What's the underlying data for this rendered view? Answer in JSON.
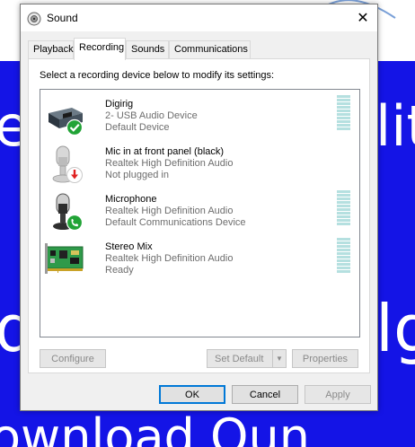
{
  "wallpaper": {
    "line1_left": "e",
    "line1_right": "lit",
    "line2_left": "d",
    "line2_right": "lg",
    "line3": "ownload Oun"
  },
  "window": {
    "title": "Sound",
    "close_glyph": "✕"
  },
  "tabs": [
    {
      "label": "Playback"
    },
    {
      "label": "Recording"
    },
    {
      "label": "Sounds"
    },
    {
      "label": "Communications"
    }
  ],
  "instruction": "Select a recording device below to modify its settings:",
  "devices": [
    {
      "name": "Digirig",
      "line2": "2- USB Audio Device",
      "line3": "Default Device",
      "icon": "usb-audio-icon",
      "badge": "checkmark-badge"
    },
    {
      "name": "Mic in at front panel (black)",
      "line2": "Realtek High Definition Audio",
      "line3": "Not plugged in",
      "icon": "microphone-icon",
      "badge": "unplugged-badge"
    },
    {
      "name": "Microphone",
      "line2": "Realtek High Definition Audio",
      "line3": "Default Communications Device",
      "icon": "microphone-icon",
      "badge": "phone-badge"
    },
    {
      "name": "Stereo Mix",
      "line2": "Realtek High Definition Audio",
      "line3": "Ready",
      "icon": "sound-card-icon",
      "badge": ""
    }
  ],
  "buttons": {
    "configure": "Configure",
    "set_default": "Set Default",
    "properties": "Properties",
    "ok": "OK",
    "cancel": "Cancel",
    "apply": "Apply"
  },
  "colors": {
    "accent": "#0078d7",
    "wallpaper": "#1414e6",
    "meter": "#b5e0e0",
    "check_green": "#21a336",
    "unplugged_red": "#e02020"
  }
}
